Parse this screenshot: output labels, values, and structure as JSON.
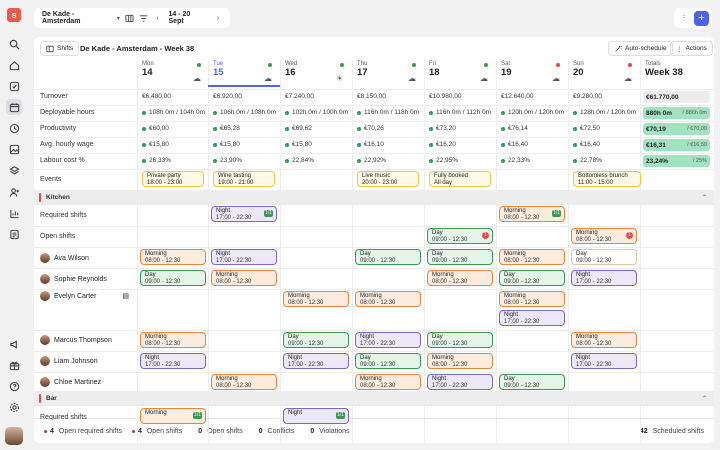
{
  "sidebar": {
    "logo": "s",
    "icons": [
      "search-icon",
      "home-icon",
      "check-circle-icon",
      "calendar-icon",
      "clock-icon",
      "image-icon",
      "layers-icon",
      "user-plus-icon",
      "bar-chart-icon",
      "document-icon",
      "megaphone-icon",
      "gift-icon",
      "help-icon",
      "settings-icon"
    ]
  },
  "topbar": {
    "location": "De Kade - Amsterdam",
    "week_range": "14 - 20 Sept",
    "prev": "‹",
    "next": "›",
    "more": "⋮",
    "add": "+"
  },
  "panel": {
    "shifts_label": "Shifts",
    "title": "De Kade - Amsterdam - Week 38",
    "auto_schedule": "Auto-schedule",
    "actions": "Actions"
  },
  "days": [
    {
      "name": "Mon",
      "date": "14",
      "dot": "#3a9a55",
      "weather": "☁"
    },
    {
      "name": "Tue",
      "date": "15",
      "dot": "#3a9a55",
      "weather": "☁"
    },
    {
      "name": "Wed",
      "date": "16",
      "dot": "#3a9a55",
      "weather": "☀"
    },
    {
      "name": "Thu",
      "date": "17",
      "dot": "#3a9a55",
      "weather": "☁"
    },
    {
      "name": "Fri",
      "date": "18",
      "dot": "#3a9a55",
      "weather": "☁"
    },
    {
      "name": "Sat",
      "date": "19",
      "dot": "#e54b4b",
      "weather": "☁"
    },
    {
      "name": "Sun",
      "date": "20",
      "dot": "#e54b4b",
      "weather": "☁"
    }
  ],
  "totals_header": {
    "name": "Totals",
    "date": "Week 38"
  },
  "metrics": [
    {
      "label": "Turnover",
      "values": [
        "€6.480,00",
        "€6.920,00",
        "€7.240,00",
        "€8.150,00",
        "€10.980,00",
        "€12.640,00",
        "€9.280,00"
      ],
      "total": "€61.770,00",
      "total_sub": "",
      "dots": [
        "",
        "",
        "",
        "",
        "",
        "",
        ""
      ]
    },
    {
      "label": "Deployable hours",
      "values": [
        "108h 0m / 104h 0m",
        "106h 0m / 108h 0m",
        "102h 0m / 100h 0m",
        "116h 0m / 118h 0m",
        "116h 0m / 112h 0m",
        "120h 0m / 120h 0m",
        "128h 0m / 120h 0m"
      ],
      "total": "880h 0m",
      "total_sub": "/ 886h 0m",
      "dots": [
        "#3a9a55",
        "#3a9a55",
        "#3a9a55",
        "#3a9a55",
        "#3a9a55",
        "#3a9a55",
        "#3a9a55"
      ]
    },
    {
      "label": "Productivity",
      "values": [
        "€60,00",
        "€65,28",
        "€69,62",
        "€70,26",
        "€73,20",
        "€76,14",
        "€72,50"
      ],
      "total": "€70,19",
      "total_sub": "/ €70,00",
      "dots": [
        "#3a9a55",
        "#3a9a55",
        "#3a9a55",
        "#3a9a55",
        "#3a9a55",
        "#3a9a55",
        "#3a9a55"
      ]
    },
    {
      "label": "Avg. hourly wage",
      "values": [
        "€15,80",
        "€15,80",
        "€15,80",
        "€16,10",
        "€16,20",
        "€16,40",
        "€16,40"
      ],
      "total": "€16,31",
      "total_sub": "/ €16,50",
      "dots": [
        "#3a9a55",
        "#3a9a55",
        "#3a9a55",
        "#3a9a55",
        "#3a9a55",
        "#3a9a55",
        "#3a9a55"
      ]
    },
    {
      "label": "Labour cost %",
      "values": [
        "26,33%",
        "23,90%",
        "22,84%",
        "22,92%",
        "22,95%",
        "22,33%",
        "22,78%"
      ],
      "total": "23,24%",
      "total_sub": "/ 25%",
      "dots": [
        "#3a9a55",
        "#3a9a55",
        "#3a9a55",
        "#3a9a55",
        "#3a9a55",
        "#3a9a55",
        "#3a9a55"
      ]
    }
  ],
  "events_label": "Events",
  "events": [
    {
      "day": 0,
      "title": "Private party",
      "time": "18:00 - 23:00"
    },
    {
      "day": 1,
      "title": "Wine tasting",
      "time": "19:00 - 21:00"
    },
    {
      "day": 3,
      "title": "Live music",
      "time": "20:00 - 23:00"
    },
    {
      "day": 4,
      "title": "Fully booked",
      "time": "All day"
    },
    {
      "day": 6,
      "title": "Bottomless brunch",
      "time": "11:00 - 15:00"
    }
  ],
  "sections": [
    {
      "name": "Kitchen",
      "caret": "⌃"
    },
    {
      "name": "Bar",
      "caret": "⌃"
    }
  ],
  "row_labels": {
    "required": "Required shifts",
    "open": "Open shifts"
  },
  "people": [
    "Ava Wilson",
    "Sophie Reynolds",
    "Evelyn Carter",
    "Marcus Thompson",
    "Liam Johnson",
    "Chloe Martinez"
  ],
  "shifts": {
    "required": [
      {
        "day": 1,
        "type": "Night",
        "time": "17:00 - 22:30",
        "color": "purple",
        "badge": "1/1"
      },
      {
        "day": 5,
        "type": "Morning",
        "time": "08:00 - 12:30",
        "color": "orange",
        "badge": "1/1"
      }
    ],
    "open": [
      {
        "day": 4,
        "type": "Day",
        "time": "09:00 - 12:30",
        "color": "green",
        "badge": "1"
      },
      {
        "day": 6,
        "type": "Morning",
        "time": "08:00 - 12:30",
        "color": "orange",
        "badge": "1"
      }
    ],
    "ava": [
      {
        "day": 0,
        "type": "Morning",
        "time": "08:00 - 12:30",
        "color": "orange"
      },
      {
        "day": 1,
        "type": "Night",
        "time": "17:00 - 22:30",
        "color": "purple"
      },
      {
        "day": 3,
        "type": "Day",
        "time": "09:00 - 12:30",
        "color": "green"
      },
      {
        "day": 4,
        "type": "Day",
        "time": "09:00 - 12:30",
        "color": "green"
      },
      {
        "day": 5,
        "type": "Morning",
        "time": "08:00 - 12:30",
        "color": "orange"
      },
      {
        "day": 6,
        "type": "Day",
        "time": "09:00 - 12:30",
        "color": "empty"
      }
    ],
    "sophie": [
      {
        "day": 0,
        "type": "Day",
        "time": "09:00 - 12:30",
        "color": "green"
      },
      {
        "day": 1,
        "type": "Morning",
        "time": "08:00 - 12:30",
        "color": "orange"
      },
      {
        "day": 4,
        "type": "Morning",
        "time": "08:00 - 12:30",
        "color": "orange"
      },
      {
        "day": 5,
        "type": "Day",
        "time": "09:00 - 12:30",
        "color": "green"
      },
      {
        "day": 6,
        "type": "Night",
        "time": "17:00 - 22:30",
        "color": "purple"
      }
    ],
    "evelyn": [
      {
        "day": 2,
        "type": "Morning",
        "time": "08:00 - 12:30",
        "color": "orange"
      },
      {
        "day": 3,
        "type": "Morning",
        "time": "08:00 - 12:30",
        "color": "orange"
      },
      {
        "day": 5,
        "type": "Morning",
        "time": "08:00 - 12:30",
        "color": "orange"
      }
    ],
    "evelyn2": [
      {
        "day": 5,
        "type": "Night",
        "time": "17:00 - 22:30",
        "color": "purple"
      }
    ],
    "marcus": [
      {
        "day": 0,
        "type": "Morning",
        "time": "08:00 - 12:30",
        "color": "orange"
      },
      {
        "day": 2,
        "type": "Day",
        "time": "09:00 - 12:30",
        "color": "green"
      },
      {
        "day": 3,
        "type": "Night",
        "time": "17:00 - 22:30",
        "color": "purple"
      },
      {
        "day": 4,
        "type": "Day",
        "time": "09:00 - 12:30",
        "color": "green"
      },
      {
        "day": 6,
        "type": "Morning",
        "time": "08:00 - 12:30",
        "color": "orange"
      }
    ],
    "liam": [
      {
        "day": 0,
        "type": "Night",
        "time": "17:00 - 22:30",
        "color": "purple"
      },
      {
        "day": 2,
        "type": "Night",
        "time": "17:00 - 22:30",
        "color": "purple"
      },
      {
        "day": 3,
        "type": "Day",
        "time": "09:00 - 12:30",
        "color": "green"
      },
      {
        "day": 4,
        "type": "Morning",
        "time": "08:00 - 12:30",
        "color": "orange"
      },
      {
        "day": 6,
        "type": "Night",
        "time": "17:00 - 22:30",
        "color": "purple"
      }
    ],
    "chloe": [
      {
        "day": 1,
        "type": "Morning",
        "time": "08:00 - 12:30",
        "color": "orange"
      },
      {
        "day": 3,
        "type": "Morning",
        "time": "08:00 - 12:30",
        "color": "orange"
      },
      {
        "day": 4,
        "type": "Night",
        "time": "17:00 - 22:30",
        "color": "purple"
      },
      {
        "day": 5,
        "type": "Day",
        "time": "09:00 - 12:30",
        "color": "green"
      }
    ],
    "bar_required": [
      {
        "day": 0,
        "type": "Morning",
        "time": "",
        "color": "orange",
        "badge": "1/1"
      },
      {
        "day": 2,
        "type": "Night",
        "time": "",
        "color": "purple",
        "badge": "1/1"
      }
    ]
  },
  "footer": {
    "items": [
      {
        "num": "4",
        "label": "Open required shifts",
        "dot": true
      },
      {
        "num": "4",
        "label": "Open shifts",
        "dot": true
      },
      {
        "num": "0",
        "label": "Open shifts",
        "dot": false
      },
      {
        "num": "0",
        "label": "Conflicts",
        "dot": false
      },
      {
        "num": "0",
        "label": "Violations",
        "dot": false
      }
    ],
    "scheduled_num": "42",
    "scheduled_label": "Scheduled shifts"
  }
}
